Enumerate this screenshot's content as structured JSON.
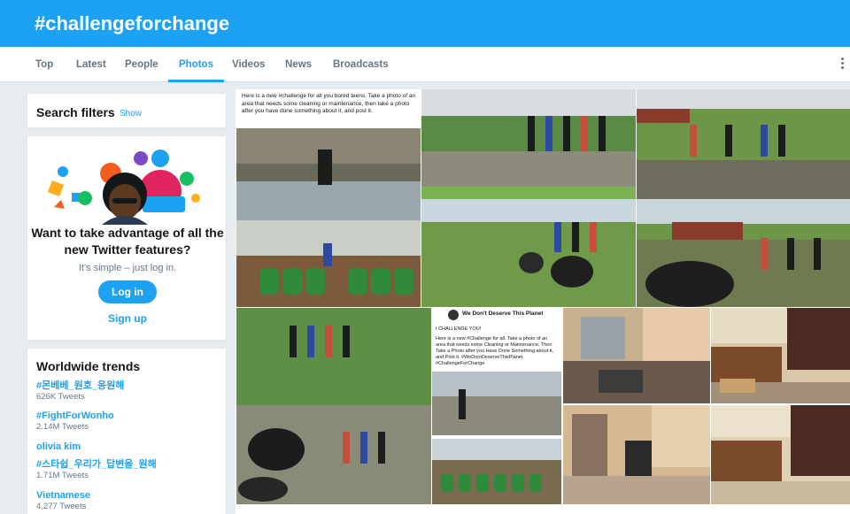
{
  "header": {
    "title": "#challengeforchange"
  },
  "tabs": [
    {
      "label": "Top"
    },
    {
      "label": "Latest"
    },
    {
      "label": "People"
    },
    {
      "label": "Photos",
      "active": true
    },
    {
      "label": "Videos"
    },
    {
      "label": "News"
    },
    {
      "label": "Broadcasts"
    }
  ],
  "search_filters": {
    "title": "Search filters",
    "show_link": "Show"
  },
  "promo": {
    "title": "Want to take advantage of all the new Twitter features?",
    "subtitle": "It's simple – just log in.",
    "login_label": "Log in",
    "signup_label": "Sign up"
  },
  "trends": {
    "title": "Worldwide trends",
    "items": [
      {
        "name": "#몬베베_원호_응원해",
        "count": "626K Tweets"
      },
      {
        "name": "#FightForWonho",
        "count": "2.14M Tweets"
      },
      {
        "name": "olivia kim",
        "count": ""
      },
      {
        "name": "#스타쉽_우리가_답변을_원해",
        "count": "1.71M Tweets"
      },
      {
        "name": "Vietnamese",
        "count": "4,277 Tweets"
      }
    ]
  },
  "photos": {
    "caption1": "Here is a new #challenge for all you bored teens. Take a photo of an area that needs some cleaning or maintenance, then take a photo after you have done something about it, and post it.",
    "fb_page": "We Don't Deserve This Planet",
    "fb_challenge": "I CHALLENGE YOU!",
    "fb_text": "Here is a new #Challenge for all. Take a photo of an area that needs some Cleaning or Maintenance, Then Take a Photo after you Have Done Something about it, and Post it. #WeDontDeserveThisPlanet #ChallengeForChange"
  },
  "colors": {
    "brand": "#1da1f2",
    "background": "#e6ecf0"
  }
}
